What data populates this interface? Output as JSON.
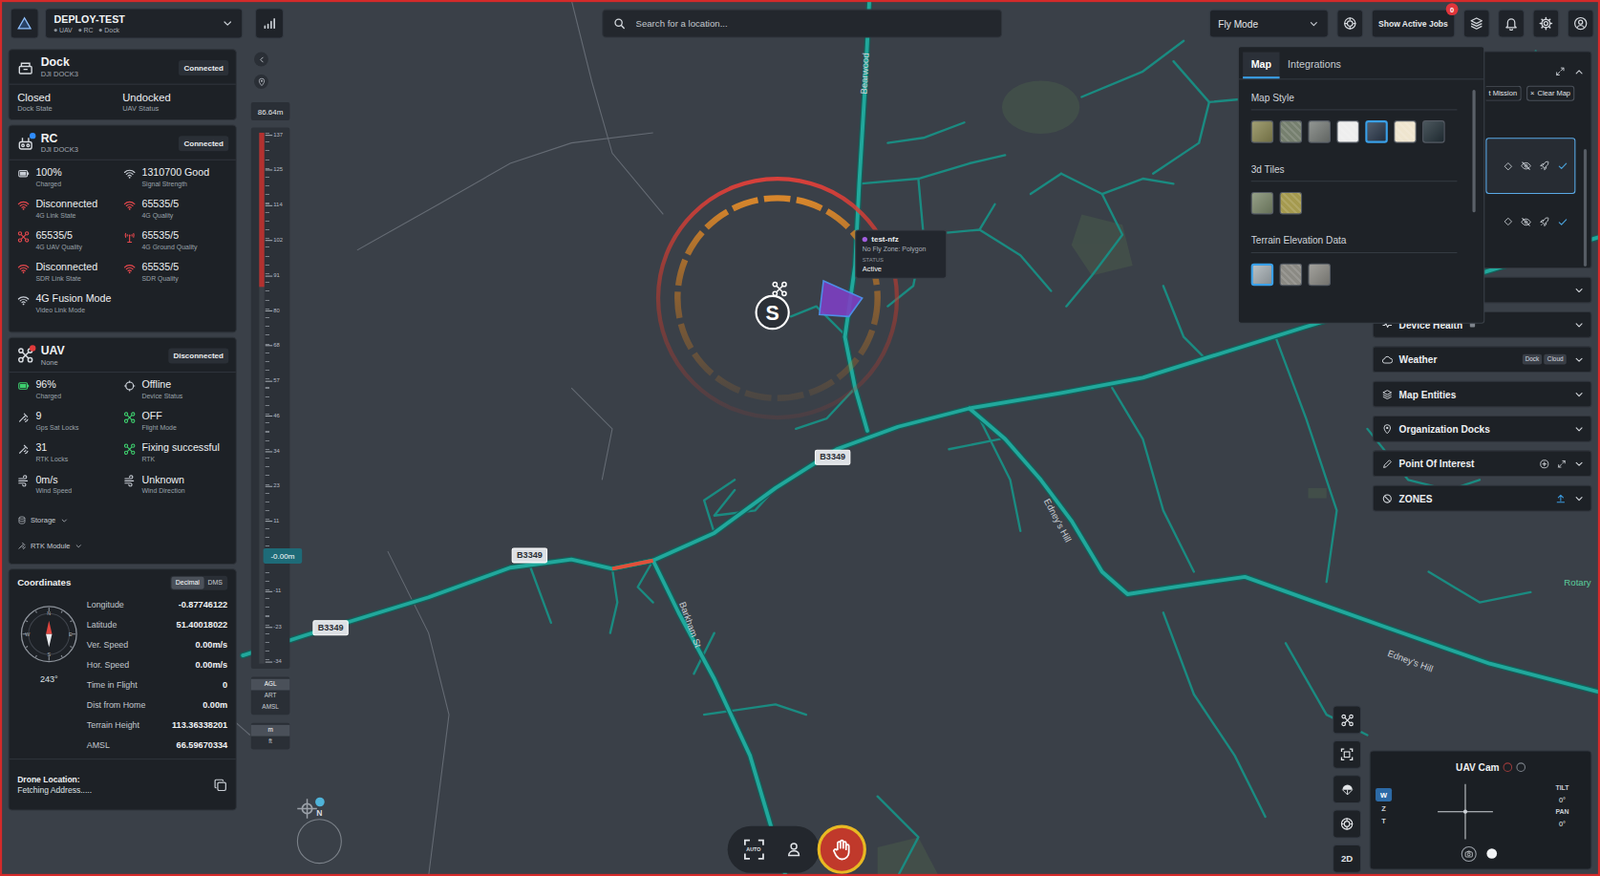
{
  "topbar": {
    "org": "DEPLOY-TEST",
    "devices": [
      "UAV",
      "RC",
      "Dock"
    ],
    "search": {
      "placeholder": "Search for a location..."
    },
    "mode": "Fly Mode",
    "jobs_button": "Show Active Jobs",
    "jobs_badge": "0"
  },
  "dock": {
    "title": "Dock",
    "model": "DJI DOCK3",
    "status": "Connected",
    "fields": [
      {
        "value": "Closed",
        "label": "Dock State"
      },
      {
        "value": "Undocked",
        "label": "UAV Status"
      }
    ]
  },
  "rc": {
    "title": "RC",
    "model": "DJI DOCK3",
    "status": "Connected",
    "dot_color": "#2f8cff",
    "stats": [
      {
        "value": "100%",
        "label": "Charged",
        "kind": "battery",
        "color": "#c9ced6"
      },
      {
        "value": "1310700 Good",
        "label": "Signal Strength",
        "kind": "wifi",
        "color": "#c9ced6"
      },
      {
        "value": "Disconnected",
        "label": "4G Link State",
        "kind": "wifi",
        "color": "#e5484d"
      },
      {
        "value": "65535/5",
        "label": "4G Quality",
        "kind": "wifi",
        "color": "#e5484d"
      },
      {
        "value": "65535/5",
        "label": "4G UAV Quality",
        "kind": "drone",
        "color": "#e5484d"
      },
      {
        "value": "65535/5",
        "label": "4G Ground Quality",
        "kind": "tower",
        "color": "#e5484d"
      },
      {
        "value": "Disconnected",
        "label": "SDR Link State",
        "kind": "wifi",
        "color": "#e5484d"
      },
      {
        "value": "65535/5",
        "label": "SDR Quality",
        "kind": "wifi",
        "color": "#e5484d"
      },
      {
        "value": "4G Fusion Mode",
        "label": "Video Link Mode",
        "kind": "wifi",
        "color": "#c9ced6"
      }
    ]
  },
  "uav": {
    "title": "UAV",
    "model": "None",
    "status": "Disconnected",
    "dot_color": "#e23b3b",
    "stats": [
      {
        "value": "96%",
        "label": "Charged",
        "kind": "battery",
        "color": "#3ecf6e"
      },
      {
        "value": "Offline",
        "label": "Device Status",
        "kind": "status",
        "color": "#c9ced6"
      },
      {
        "value": "9",
        "label": "Gps Sat Locks",
        "kind": "satellite",
        "color": "#c9ced6"
      },
      {
        "value": "OFF",
        "label": "Flight Mode",
        "kind": "drone",
        "color": "#3ecf6e"
      },
      {
        "value": "31",
        "label": "RTK Locks",
        "kind": "satellite",
        "color": "#c9ced6"
      },
      {
        "value": "Fixing successful",
        "label": "RTK",
        "kind": "drone",
        "color": "#3ecf6e"
      },
      {
        "value": "0m/s",
        "label": "Wind Speed",
        "kind": "wind",
        "color": "#c9ced6"
      },
      {
        "value": "Unknown",
        "label": "Wind Direction",
        "kind": "wind",
        "color": "#c9ced6"
      }
    ],
    "expanders": [
      {
        "label": "Storage",
        "expanded": false
      },
      {
        "label": "RTK Module",
        "expanded": false
      }
    ]
  },
  "coordinates": {
    "title": "Coordinates",
    "formats": [
      {
        "label": "Decimal",
        "selected": true
      },
      {
        "label": "DMS",
        "selected": false
      }
    ],
    "compass_letters": [
      "N",
      "E",
      "S",
      "W"
    ],
    "heading": "243°",
    "rows": [
      {
        "label": "Longitude",
        "value": "-0.87746122"
      },
      {
        "label": "Latitude",
        "value": "51.40018022"
      },
      {
        "label": "Ver. Speed",
        "value": "0.00m/s"
      },
      {
        "label": "Hor. Speed",
        "value": "0.00m/s"
      },
      {
        "label": "Time in Flight",
        "value": "0"
      },
      {
        "label": "Dist from Home",
        "value": "0.00m"
      },
      {
        "label": "Terrain Height",
        "value": "113.36338201"
      },
      {
        "label": "AMSL",
        "value": "66.59670334"
      }
    ],
    "location_label": "Drone Location:",
    "location_value": "Fetching Address....."
  },
  "altitude": {
    "top": "86.64m",
    "ticks": [
      "137",
      "125",
      "114",
      "102",
      "91",
      "80",
      "68",
      "57",
      "46",
      "34",
      "23",
      "11",
      "-11",
      "-23",
      "-34"
    ],
    "current": "-0.00m",
    "danger_level": 0.29,
    "references": [
      {
        "label": "AGL",
        "selected": true
      },
      {
        "label": "ART",
        "selected": false
      },
      {
        "label": "AMSL",
        "selected": false
      }
    ],
    "units": [
      {
        "label": "m",
        "selected": true
      },
      {
        "label": "ft",
        "selected": false
      }
    ]
  },
  "map": {
    "road_labels": [
      "B3349",
      "B3349",
      "B3349"
    ],
    "street_names": [
      "Bearwood",
      "Edney's Hill",
      "Edney's Hill",
      "Barkham St"
    ],
    "place_labels": [
      "Rotary"
    ],
    "home_marker": "S",
    "nfz_tooltip": {
      "name": "test-nfz",
      "type": "No Fly Zone: Polygon",
      "status_label": "STATUS",
      "status": "Active"
    },
    "north": "N"
  },
  "map_settings": {
    "tabs": [
      {
        "label": "Map",
        "selected": true
      },
      {
        "label": "Integrations",
        "selected": false
      }
    ],
    "sections": [
      {
        "title": "Map Style",
        "options": [
          {
            "selected": false,
            "color": "#8d8a55"
          },
          {
            "selected": false,
            "color": "#76806f"
          },
          {
            "selected": false,
            "color": "#7a7f7b"
          },
          {
            "selected": false,
            "color": "#eeeeee"
          },
          {
            "selected": true,
            "color": "#2c3a4d"
          },
          {
            "selected": false,
            "color": "#efe5cf"
          },
          {
            "selected": false,
            "color": "#25333b"
          }
        ]
      },
      {
        "title": "3d Tiles",
        "options": [
          {
            "selected": false,
            "color": "#7f8c6e"
          },
          {
            "selected": false,
            "color": "#a59a4f"
          }
        ]
      },
      {
        "title": "Terrain Elevation Data",
        "options": [
          {
            "selected": true,
            "color": "#a9b2b7"
          },
          {
            "selected": false,
            "color": "#8b8a84"
          },
          {
            "selected": false,
            "color": "#8f8e88"
          }
        ]
      }
    ]
  },
  "sidebar": {
    "panel_expanded": true,
    "actions": [
      {
        "label": "t Mission"
      },
      {
        "label": "Clear Map",
        "icon": "×"
      }
    ],
    "missions": [
      {
        "selected": true
      },
      {
        "selected": false
      }
    ],
    "sections": [
      {
        "expanded": false
      },
      {
        "title": "Device Health",
        "expanded": false
      },
      {
        "title": "Weather",
        "expanded": false,
        "badges": [
          "Dock",
          "Cloud"
        ]
      },
      {
        "title": "Map Entities",
        "expanded": false
      },
      {
        "title": "Organization Docks",
        "expanded": false
      },
      {
        "title": "Point Of Interest",
        "expanded": false
      },
      {
        "title": "ZONES",
        "expanded": false
      }
    ]
  },
  "camera": {
    "title": "UAV Cam",
    "zoom": [
      {
        "label": "W",
        "selected": true
      },
      {
        "label": "Z",
        "selected": false
      },
      {
        "label": "T",
        "selected": false
      }
    ],
    "readouts": [
      {
        "label": "TILT",
        "value": "0°"
      },
      {
        "label": "PAN",
        "value": "0°"
      }
    ]
  },
  "map_tools": {
    "view_toggle": "2D"
  },
  "flight": {
    "auto": "AUTO"
  }
}
